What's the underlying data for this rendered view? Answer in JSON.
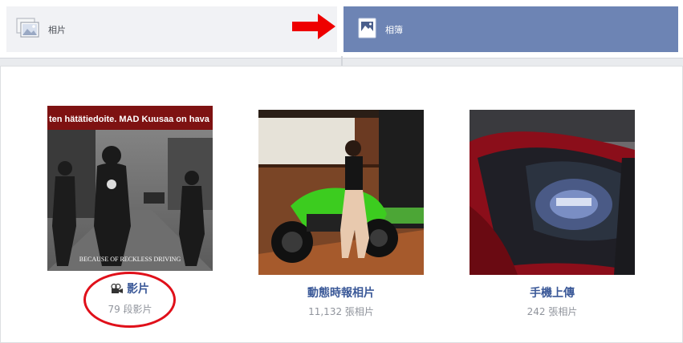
{
  "tabs": {
    "photos_label": "相片",
    "albums_label": "相簿"
  },
  "albums": [
    {
      "title": "影片",
      "count": "79 段影片",
      "type": "video",
      "overlay_text": "ten hätätiedoite. MAD Kuusaa on hava",
      "caption_text": "BECAUSE OF RECKLESS DRIVING"
    },
    {
      "title": "動態時報相片",
      "count": "11,132 張相片",
      "type": "album"
    },
    {
      "title": "手機上傳",
      "count": "242 張相片",
      "type": "album"
    }
  ],
  "colors": {
    "active_tab": "#6d84b4",
    "inactive_tab": "#f1f2f5",
    "link": "#3b5998",
    "annotation_red": "#e0101a"
  },
  "icons": {
    "photos_tab": "photo-stack-icon",
    "albums_tab": "album-icon",
    "video": "video-camera-icon",
    "annotation": "red-arrow"
  }
}
